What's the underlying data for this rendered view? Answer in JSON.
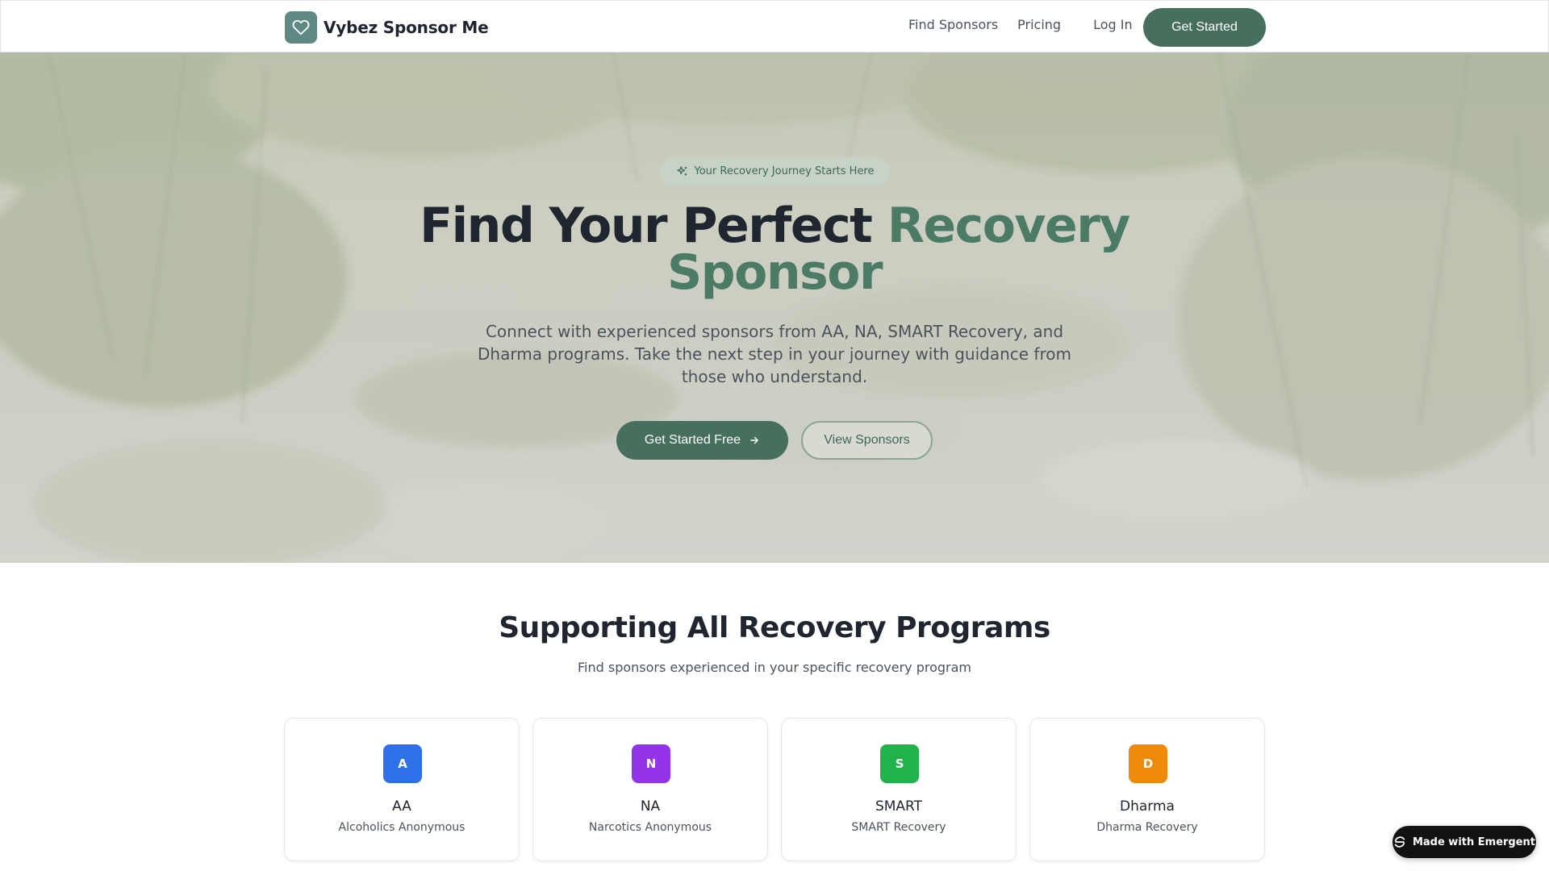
{
  "nav": {
    "brand_name": "Vybez Sponsor Me",
    "brand_icon": "heart-icon",
    "links": [
      "Find Sponsors",
      "Pricing",
      "Log In"
    ],
    "cta": "Get Started",
    "accent_color": "#466f5e"
  },
  "hero": {
    "badge": "Your Recovery Journey Starts Here",
    "badge_icon": "sparkles-icon",
    "title_part1": "Find Your Perfect ",
    "title_accent_line1": "Recovery",
    "title_accent_line2": "Sponsor",
    "subtitle": "Connect with experienced sponsors from AA, NA, SMART Recovery, and Dharma programs. Take the next step in your journey with guidance from those who understand.",
    "primary_cta": "Get Started Free",
    "secondary_cta": "View Sponsors"
  },
  "programs": {
    "title": "Supporting All Recovery Programs",
    "subtitle": "Find sponsors experienced in your specific recovery program",
    "items": [
      {
        "letter": "A",
        "name": "AA",
        "desc": "Alcoholics Anonymous",
        "color": "#2f6fe8"
      },
      {
        "letter": "N",
        "name": "NA",
        "desc": "Narcotics Anonymous",
        "color": "#9333ea"
      },
      {
        "letter": "S",
        "name": "SMART",
        "desc": "SMART Recovery",
        "color": "#22b24c"
      },
      {
        "letter": "D",
        "name": "Dharma",
        "desc": "Dharma Recovery",
        "color": "#f08a0c"
      }
    ]
  },
  "badge_made_with": "Made with Emergent"
}
